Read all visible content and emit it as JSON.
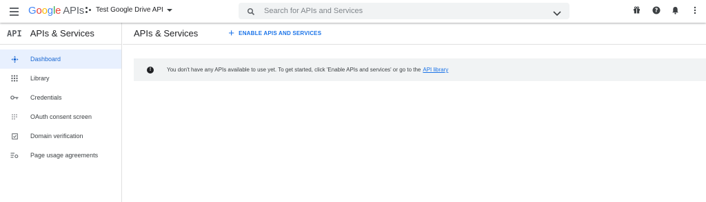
{
  "header": {
    "logo_letters": [
      "G",
      "o",
      "o",
      "g",
      "l",
      "e"
    ],
    "logo_suffix": "APIs",
    "project_name": "Test Google Drive API",
    "search_placeholder": "Search for APIs and Services",
    "icons": [
      "menu-icon",
      "search-icon",
      "chevron-down-icon",
      "gift-icon",
      "help-icon",
      "notifications-icon",
      "more-vert-icon"
    ]
  },
  "sidebar": {
    "badge": "API",
    "title": "APIs & Services",
    "items": [
      {
        "label": "Dashboard",
        "icon": "dashboard-icon",
        "active": true
      },
      {
        "label": "Library",
        "icon": "library-icon",
        "active": false
      },
      {
        "label": "Credentials",
        "icon": "key-icon",
        "active": false
      },
      {
        "label": "OAuth consent screen",
        "icon": "oauth-icon",
        "active": false
      },
      {
        "label": "Domain verification",
        "icon": "checkbox-icon",
        "active": false
      },
      {
        "label": "Page usage agreements",
        "icon": "settings-list-icon",
        "active": false
      }
    ]
  },
  "main": {
    "title": "APIs & Services",
    "enable_button": "ENABLE APIS AND SERVICES",
    "banner": {
      "text": "You don't have any APIs available to use yet. To get started, click 'Enable APIs and services' or go to the",
      "link": "API library"
    }
  },
  "colors": {
    "accent": "#1a73e8",
    "active_bg": "#e8f0fe",
    "banner_bg": "#f1f3f4"
  }
}
